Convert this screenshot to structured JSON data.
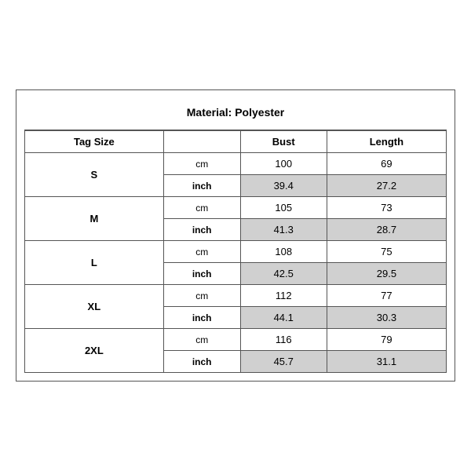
{
  "title": "Material: Polyester",
  "headers": {
    "tag_size": "Tag Size",
    "bust": "Bust",
    "length": "Length"
  },
  "sizes": [
    {
      "tag": "S",
      "cm": {
        "bust": "100",
        "length": "69"
      },
      "inch": {
        "bust": "39.4",
        "length": "27.2"
      }
    },
    {
      "tag": "M",
      "cm": {
        "bust": "105",
        "length": "73"
      },
      "inch": {
        "bust": "41.3",
        "length": "28.7"
      }
    },
    {
      "tag": "L",
      "cm": {
        "bust": "108",
        "length": "75"
      },
      "inch": {
        "bust": "42.5",
        "length": "29.5"
      }
    },
    {
      "tag": "XL",
      "cm": {
        "bust": "112",
        "length": "77"
      },
      "inch": {
        "bust": "44.1",
        "length": "30.3"
      }
    },
    {
      "tag": "2XL",
      "cm": {
        "bust": "116",
        "length": "79"
      },
      "inch": {
        "bust": "45.7",
        "length": "31.1"
      }
    }
  ],
  "units": {
    "cm": "cm",
    "inch": "inch"
  }
}
